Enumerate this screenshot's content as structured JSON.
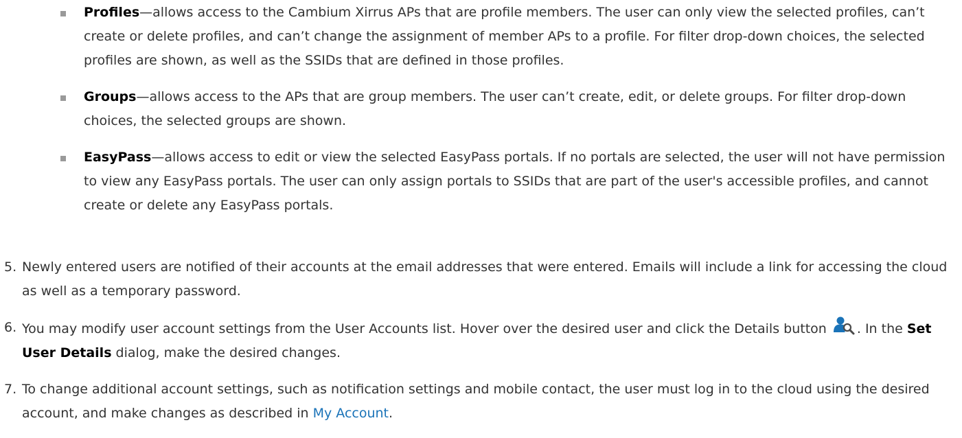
{
  "bullets": [
    {
      "term": "Profiles",
      "text": "—allows access to the Cambium Xirrus APs that are profile members. The user can only view the selected profiles, can’t create or delete profiles, and can’t change the assignment of member APs to a profile. For filter drop-down choices, the selected profiles are shown, as well as the SSIDs that are defined in those profiles."
    },
    {
      "term": "Groups",
      "text": "—allows access to the APs that are group members. The user can’t create, edit, or delete groups. For filter drop-down choices, the selected groups are shown."
    },
    {
      "term": "EasyPass",
      "text": "—allows access to edit or view the selected EasyPass portals. If no portals are selected, the user will not have permission to view any EasyPass portals. The user can only assign portals to SSIDs that are part of the user's accessible profiles, and cannot create or delete any EasyPass portals."
    }
  ],
  "steps": {
    "s5": {
      "number": "5.",
      "text": "Newly entered users are notified of their accounts at the email addresses that were entered. Emails will include a link for accessing the cloud as well as a temporary password."
    },
    "s6": {
      "number": "6.",
      "text_a": "You may modify user account settings from the User Accounts list. Hover over the desired user and click the Details button ",
      "text_b": ". In the ",
      "bold": "Set User Details",
      "text_c": " dialog, make the desired changes.",
      "icon": "user-search-icon",
      "icon_color": "#1a73b8"
    },
    "s7": {
      "number": "7.",
      "text_a": "To change additional account settings, such as notification settings and mobile contact,  the  user  must  log in to the  cloud  using the  desired account, and make changes as described in ",
      "link": "My Account",
      "text_b": "."
    }
  },
  "colors": {
    "text": "#333333",
    "emphasis": "#000000",
    "link": "#1a73b8",
    "bullet": "#9a9a9a"
  }
}
